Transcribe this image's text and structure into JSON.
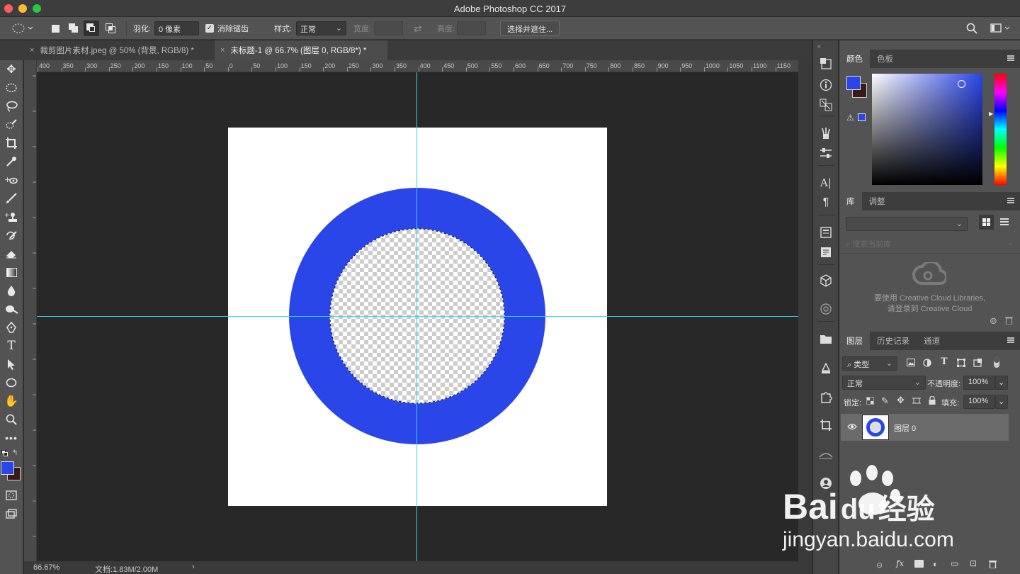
{
  "window": {
    "title": "Adobe Photoshop CC 2017"
  },
  "options": {
    "feather_label": "羽化:",
    "feather_value": "0 像素",
    "antialias_label": "消除锯齿",
    "style_label": "样式:",
    "style_value": "正常",
    "width_label": "宽度:",
    "height_label": "高度:",
    "select_mask_button": "选择并遮住..."
  },
  "tabs": [
    {
      "label": "裁剪图片素材.jpeg @ 50% (背景, RGB/8) *"
    },
    {
      "label": "未标题-1 @ 66.7% (图层 0, RGB/8*) *"
    }
  ],
  "ruler": {
    "h_ticks": [
      "400",
      "350",
      "300",
      "250",
      "200",
      "150",
      "100",
      "50",
      "0",
      "50",
      "100",
      "150",
      "200",
      "250",
      "300",
      "350",
      "400",
      "450",
      "500",
      "550",
      "600",
      "650",
      "700",
      "750",
      "800",
      "850",
      "900",
      "950",
      "1000",
      "1050",
      "1100",
      "1150"
    ]
  },
  "status": {
    "zoom": "66.67%",
    "doc": "文档:1.83M/2.00M"
  },
  "panels": {
    "color": {
      "tabs": [
        "颜色",
        "色板"
      ],
      "foreground": "#2a45e8",
      "background": "#3a1a16"
    },
    "library": {
      "tabs": [
        "库",
        "调整"
      ],
      "search_placeholder": "搜索当前库",
      "message_line1": "要使用 Creative Cloud Libraries,",
      "message_line2": "请登录到 Creative Cloud"
    },
    "layers": {
      "tabs": [
        "图层",
        "历史记录",
        "通道"
      ],
      "filter_label": "类型",
      "blend_mode": "正常",
      "opacity_label": "不透明度:",
      "opacity_value": "100%",
      "lock_label": "锁定:",
      "fill_label": "填充:",
      "fill_value": "100%",
      "items": [
        {
          "name": "图层 0",
          "visible": true
        }
      ]
    }
  },
  "artwork": {
    "ring_color": "#2a45e8"
  },
  "watermark": {
    "brand": "Bai",
    "brand_suffix": "du",
    "brand_cn": "经验",
    "url": "jingyan.baidu.com"
  }
}
